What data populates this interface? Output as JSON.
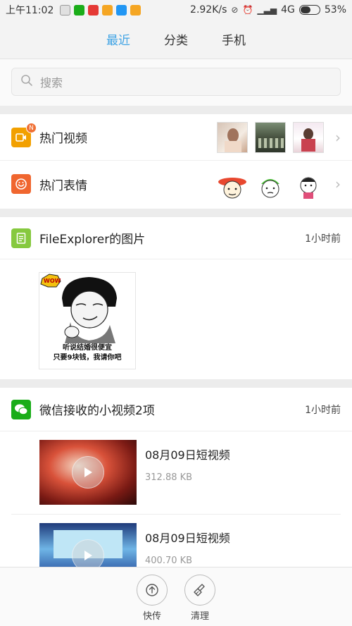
{
  "status_bar": {
    "time": "上午11:02",
    "speed": "2.92K/s",
    "network": "4G",
    "battery": "53%",
    "battery_level": 0.53,
    "app_icon_colors": [
      "#e8e8e8",
      "#1aad19",
      "#e53935",
      "#f5a623",
      "#2196f3",
      "#f5a623"
    ]
  },
  "tabs": [
    {
      "label": "最近",
      "active": true
    },
    {
      "label": "分类",
      "active": false
    },
    {
      "label": "手机",
      "active": false
    }
  ],
  "search": {
    "placeholder": "搜索"
  },
  "hot": {
    "video": {
      "title": "热门视频",
      "badge": "N",
      "icon_color": "#f2a000"
    },
    "emoji": {
      "title": "热门表情",
      "icon_color": "#f0662f"
    }
  },
  "file_explorer": {
    "title": "FileExplorer的图片",
    "time": "1小时前",
    "icon_color": "#86c93f",
    "image_caption_line1": "听说结婚很便宜",
    "image_caption_line2": "只要9块钱，我请你吧",
    "image_badge": "WOW"
  },
  "wechat": {
    "title": "微信接收的小视频2项",
    "time": "1小时前",
    "icon_color": "#1aad19",
    "videos": [
      {
        "name": "08月09日短视频",
        "size": "312.88 KB"
      },
      {
        "name": "08月09日短视频",
        "size": "400.70 KB"
      }
    ]
  },
  "bottom": {
    "send": "快传",
    "clean": "清理"
  }
}
